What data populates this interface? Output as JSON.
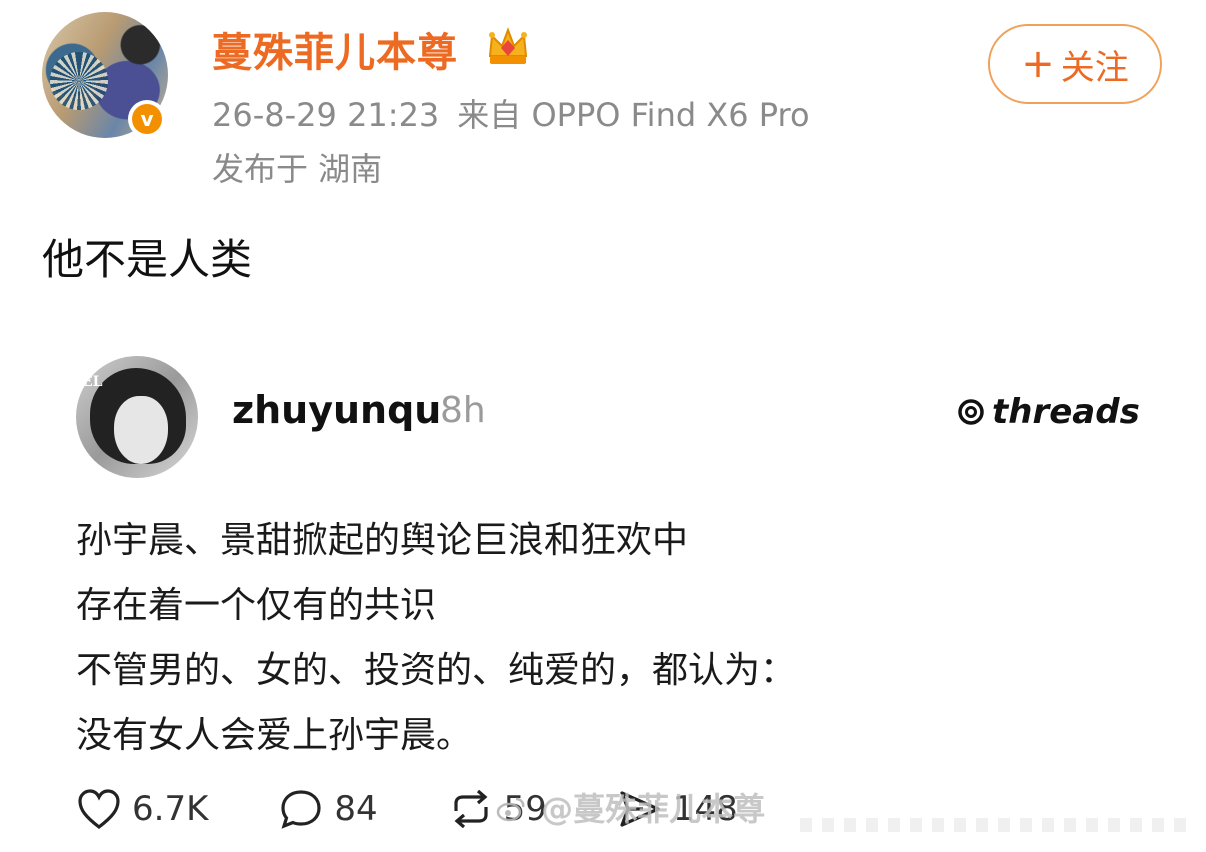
{
  "post": {
    "username": "蔓殊菲儿本尊",
    "timestamp": "26-8-29 21:23",
    "source": "来自 OPPO Find X6 Pro",
    "location": "发布于 湖南",
    "follow_plus": "+",
    "follow_label": "关注",
    "verified_badge": "v",
    "text": "他不是人类"
  },
  "embedded": {
    "avatar_tag": "EL",
    "username": "zhuyunqu",
    "time": "8h",
    "platform": "threads",
    "lines": [
      "孙宇晨、景甜掀起的舆论巨浪和狂欢中",
      "存在着一个仅有的共识",
      "不管男的、女的、投资的、纯爱的，都认为：",
      "没有女人会爱上孙宇晨。"
    ],
    "likes": "6.7K",
    "comments": "84",
    "reposts": "59",
    "shares": "148"
  },
  "watermark": "@蔓殊菲儿本尊",
  "colors": {
    "accent": "#ec6a21",
    "verified": "#f29000",
    "meta": "#8a8a8a"
  },
  "icons": {
    "crown": "crown-icon",
    "like": "heart-icon",
    "comment": "comment-icon",
    "repost": "repost-icon",
    "share": "send-icon"
  }
}
